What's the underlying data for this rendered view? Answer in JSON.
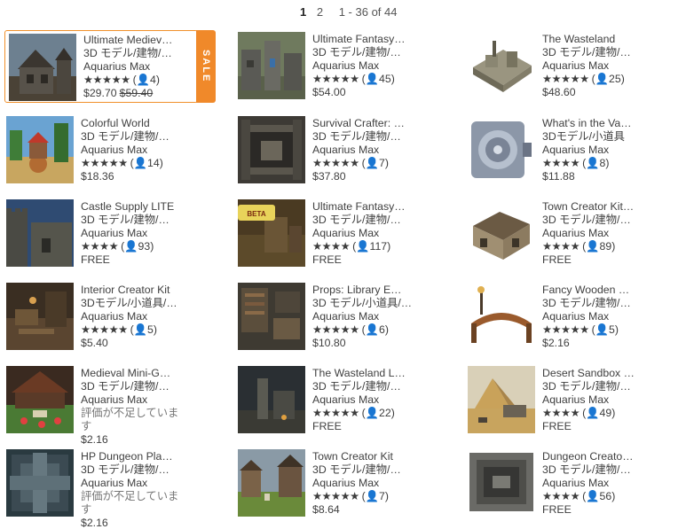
{
  "pagination": {
    "pages": [
      "1",
      "2"
    ],
    "current": "1",
    "range": "1 - 36 of 44"
  },
  "sale_label": "SALE",
  "products": [
    {
      "title": "Ultimate Mediev…",
      "category": "3D モデル/建物/…",
      "publisher": "Aquarius Max",
      "rating": "★★★★★",
      "rating_count": "(👤4)",
      "price": "$29.70",
      "old_price": "$59.40",
      "sale": true,
      "thumb": "medieval-house"
    },
    {
      "title": "Ultimate Fantasy…",
      "category": "3D モデル/建物/…",
      "publisher": "Aquarius Max",
      "rating": "★★★★★",
      "rating_count": "(👤45)",
      "price": "$54.00",
      "thumb": "fantasy-castle"
    },
    {
      "title": "The Wasteland",
      "category": "3D モデル/建物/…",
      "publisher": "Aquarius Max",
      "rating": "★★★★★",
      "rating_count": "(👤25)",
      "price": "$48.60",
      "thumb": "wasteland"
    },
    {
      "title": "Colorful World",
      "category": "3D モデル/建物/…",
      "publisher": "Aquarius Max",
      "rating": "★★★★★",
      "rating_count": "(👤14)",
      "price": "$18.36",
      "thumb": "colorful-world"
    },
    {
      "title": "Survival Crafter: …",
      "category": "3D モデル/建物/…",
      "publisher": "Aquarius Max",
      "rating": "★★★★★",
      "rating_count": "(👤7)",
      "price": "$37.80",
      "thumb": "survival-crafter"
    },
    {
      "title": "What's in the Va…",
      "category": "3Dモデル/小道具",
      "publisher": "Aquarius Max",
      "rating": "★★★★",
      "rating_count": "(👤8)",
      "price": "$11.88",
      "thumb": "vault"
    },
    {
      "title": "Castle Supply LITE",
      "category": "3D モデル/建物/…",
      "publisher": "Aquarius Max",
      "rating": "★★★★",
      "rating_count": "(👤93)",
      "price": "FREE",
      "thumb": "castle-supply"
    },
    {
      "title": "Ultimate Fantasy…",
      "category": "3D モデル/建物/…",
      "publisher": "Aquarius Max",
      "rating": "★★★★",
      "rating_count": "(👤117)",
      "price": "FREE",
      "thumb": "fantasy-beta"
    },
    {
      "title": "Town Creator Kit…",
      "category": "3D モデル/建物/…",
      "publisher": "Aquarius Max",
      "rating": "★★★★",
      "rating_count": "(👤89)",
      "price": "FREE",
      "thumb": "town-kit-house"
    },
    {
      "title": "Interior Creator Kit",
      "category": "3Dモデル/小道具/…",
      "publisher": "Aquarius Max",
      "rating": "★★★★★",
      "rating_count": "(👤5)",
      "price": "$5.40",
      "thumb": "interior"
    },
    {
      "title": "Props: Library E…",
      "category": "3D モデル/小道具/…",
      "publisher": "Aquarius Max",
      "rating": "★★★★★",
      "rating_count": "(👤6)",
      "price": "$10.80",
      "thumb": "library"
    },
    {
      "title": "Fancy Wooden …",
      "category": "3D モデル/建物/…",
      "publisher": "Aquarius Max",
      "rating": "★★★★★",
      "rating_count": "(👤5)",
      "price": "$2.16",
      "thumb": "bridge"
    },
    {
      "title": "Medieval Mini-G…",
      "category": "3D モデル/建物/…",
      "publisher": "Aquarius Max",
      "no_review": "評価が不足していま す",
      "price": "$2.16",
      "thumb": "mini-golf"
    },
    {
      "title": "The Wasteland L…",
      "category": "3D モデル/建物/…",
      "publisher": "Aquarius Max",
      "rating": "★★★★★",
      "rating_count": "(👤22)",
      "price": "FREE",
      "thumb": "wasteland-lite"
    },
    {
      "title": "Desert Sandbox …",
      "category": "3D モデル/建物/…",
      "publisher": "Aquarius Max",
      "rating": "★★★★",
      "rating_count": "(👤49)",
      "price": "FREE",
      "thumb": "desert"
    },
    {
      "title": "HP Dungeon Pla…",
      "category": "3D モデル/建物/…",
      "publisher": "Aquarius Max",
      "no_review": "評価が不足していま す",
      "price": "$2.16",
      "thumb": "dungeon-pla"
    },
    {
      "title": "Town Creator Kit",
      "category": "3D モデル/建物/…",
      "publisher": "Aquarius Max",
      "rating": "★★★★★",
      "rating_count": "(👤7)",
      "price": "$8.64",
      "thumb": "town-kit"
    },
    {
      "title": "Dungeon Creato…",
      "category": "3D モデル/建物/…",
      "publisher": "Aquarius Max",
      "rating": "★★★★",
      "rating_count": "(👤56)",
      "price": "FREE",
      "thumb": "dungeon-creator"
    }
  ]
}
